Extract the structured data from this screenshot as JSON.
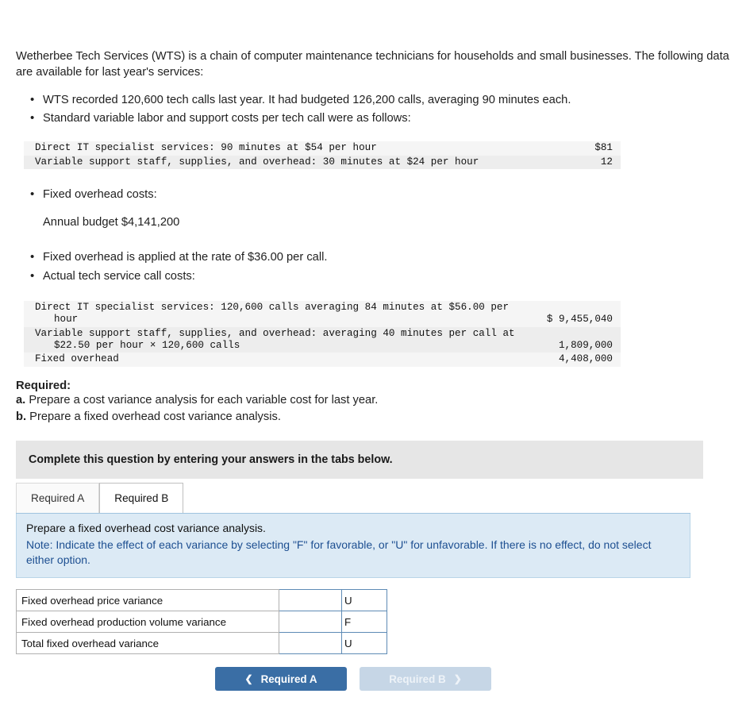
{
  "problem": {
    "intro": "Wetherbee Tech Services (WTS) is a chain of computer maintenance technicians for households and small businesses. The following data are available for last year's services:",
    "bullets": [
      "WTS recorded 120,600 tech calls last year. It had budgeted 126,200 calls, averaging 90 minutes each.",
      "Standard variable labor and support costs per tech call were as follows:"
    ],
    "standard_cost_table": [
      {
        "label": "Direct IT specialist services: 90 minutes at $54 per hour",
        "amount": "$81"
      },
      {
        "label": "Variable support staff, supplies, and overhead: 30 minutes at $24 per hour",
        "amount": "12"
      }
    ],
    "bullet_fixed_overhead": "Fixed overhead costs:",
    "annual_budget_line": "Annual budget $4,141,200",
    "bullets2": [
      "Fixed overhead is applied at the rate of $36.00 per call.",
      "Actual tech service call costs:"
    ],
    "actual_cost_table": [
      {
        "label": "Direct IT specialist services: 120,600 calls averaging 84 minutes at $56.00 per",
        "label2": "hour",
        "amount": "$ 9,455,040"
      },
      {
        "label": "Variable support staff, supplies, and overhead: averaging 40 minutes per call at",
        "label2": "$22.50 per hour × 120,600 calls",
        "amount": "1,809,000"
      },
      {
        "label": "Fixed overhead",
        "label2": "",
        "amount": "4,408,000"
      }
    ],
    "required_heading": "Required:",
    "required_a": "a. Prepare a cost variance analysis for each variable cost for last year.",
    "required_b": "b. Prepare a fixed overhead cost variance analysis."
  },
  "banner": {
    "text": "Complete this question by entering your answers in the tabs below."
  },
  "tabs": [
    {
      "label": "Required A",
      "active": false
    },
    {
      "label": "Required B",
      "active": true
    }
  ],
  "note": {
    "line1": "Prepare a fixed overhead cost variance analysis.",
    "line2": "Note: Indicate the effect of each variance by selecting \"F\" for favorable, or \"U\" for unfavorable. If there is no effect, do not select either option."
  },
  "answer_rows": [
    {
      "name": "Fixed overhead price variance",
      "value": "",
      "effect": "U"
    },
    {
      "name": "Fixed overhead production volume variance",
      "value": "",
      "effect": "F"
    },
    {
      "name": "Total fixed overhead variance",
      "value": "",
      "effect": "U"
    }
  ],
  "nav": {
    "prev_label": "Required A",
    "next_label": "Required B",
    "prev_icon": "chevron-left-icon",
    "next_icon": "chevron-right-icon"
  },
  "colors": {
    "accent": "#3a6ea5",
    "note_bg": "#dceaf5",
    "banner_bg": "#e6e6e6"
  }
}
